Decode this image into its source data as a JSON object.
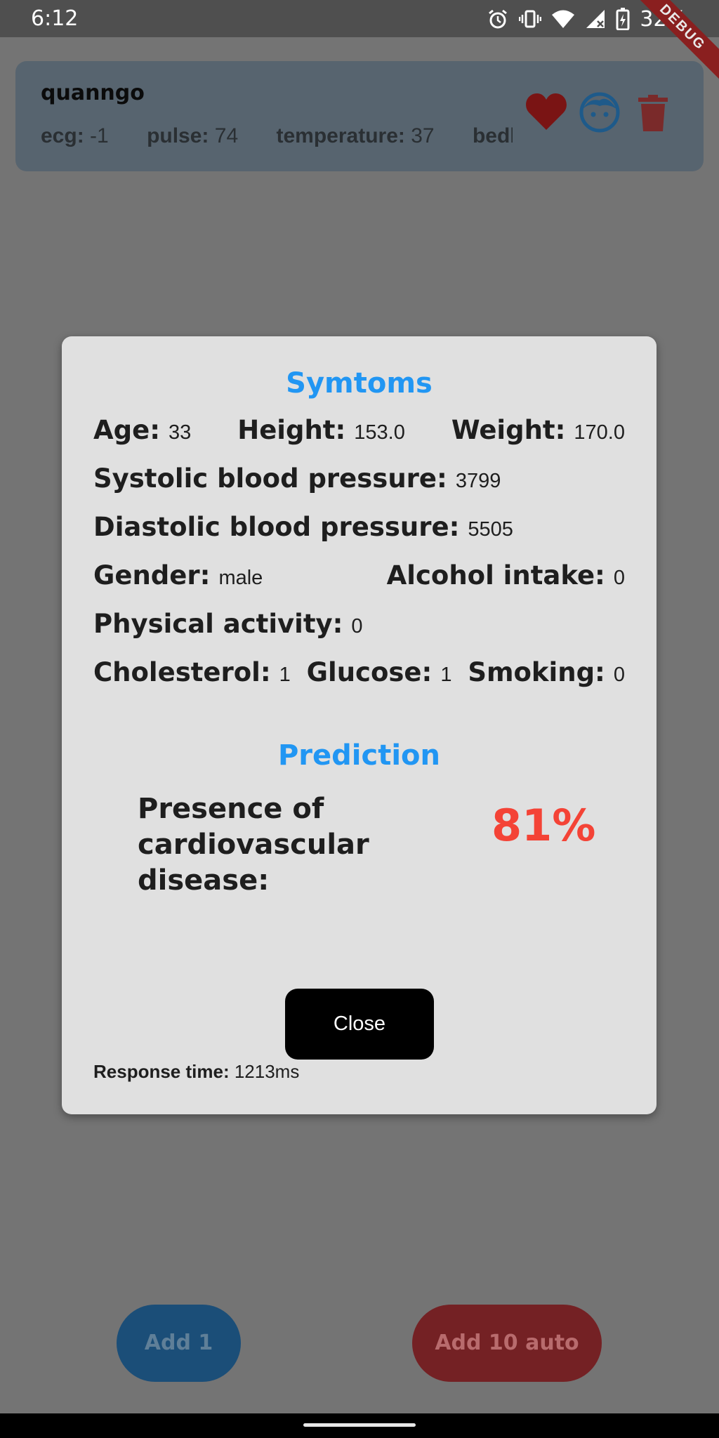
{
  "status_bar": {
    "time": "6:12",
    "battery": "32%",
    "debug_banner": "DEBUG"
  },
  "patient_card": {
    "name": "quanngo",
    "vitals": [
      {
        "label": "ecg:",
        "value": "-1"
      },
      {
        "label": "pulse:",
        "value": "74"
      },
      {
        "label": "temperature:",
        "value": "37"
      },
      {
        "label": "bedloc",
        "value": ""
      }
    ],
    "icons": [
      "heart-icon",
      "face-icon",
      "trash-icon"
    ],
    "colors": {
      "heart": "#7a1414",
      "face": "#1e5a8a",
      "trash": "#7a2a2a"
    }
  },
  "dialog": {
    "symptoms_title": "Symtoms",
    "age": {
      "label": "Age:",
      "value": "33"
    },
    "height": {
      "label": "Height:",
      "value": "153.0"
    },
    "weight": {
      "label": "Weight:",
      "value": "170.0"
    },
    "systolic": {
      "label": "Systolic blood pressure:",
      "value": "3799"
    },
    "diastolic": {
      "label": "Diastolic blood pressure:",
      "value": "5505"
    },
    "gender": {
      "label": "Gender:",
      "value": "male"
    },
    "alcohol": {
      "label": "Alcohol intake:",
      "value": "0"
    },
    "physical": {
      "label": "Physical activity:",
      "value": "0"
    },
    "cholesterol": {
      "label": "Cholesterol:",
      "value": "1"
    },
    "glucose": {
      "label": "Glucose:",
      "value": "1"
    },
    "smoking": {
      "label": "Smoking:",
      "value": "0"
    },
    "prediction_title": "Prediction",
    "prediction_label_line1": "Presence of",
    "prediction_label_line2": "cardiovascular disease:",
    "prediction_value": "81%",
    "close_label": "Close",
    "response_label": "Response time:",
    "response_value": "1213ms"
  },
  "buttons": {
    "add_one": "Add 1",
    "add_ten": "Add 10 auto"
  },
  "colors": {
    "accent": "#2196f3",
    "danger": "#f44336"
  }
}
